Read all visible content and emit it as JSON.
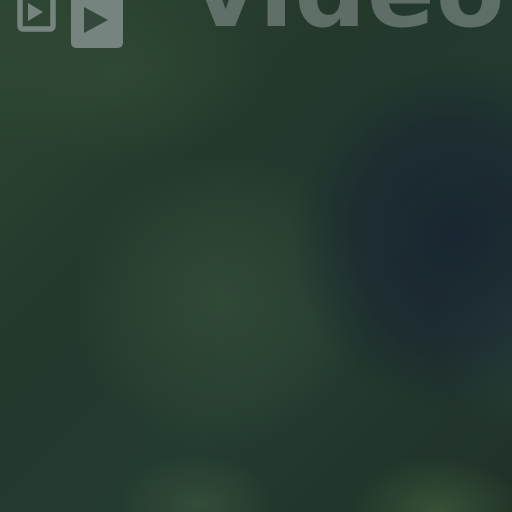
{
  "header": {
    "wordmark": "video"
  },
  "icons": {
    "small": "play-icon",
    "large": "play-icon"
  },
  "colors": {
    "background": "#26392f",
    "icon": "#75847e",
    "wordmark": "#75847e"
  }
}
